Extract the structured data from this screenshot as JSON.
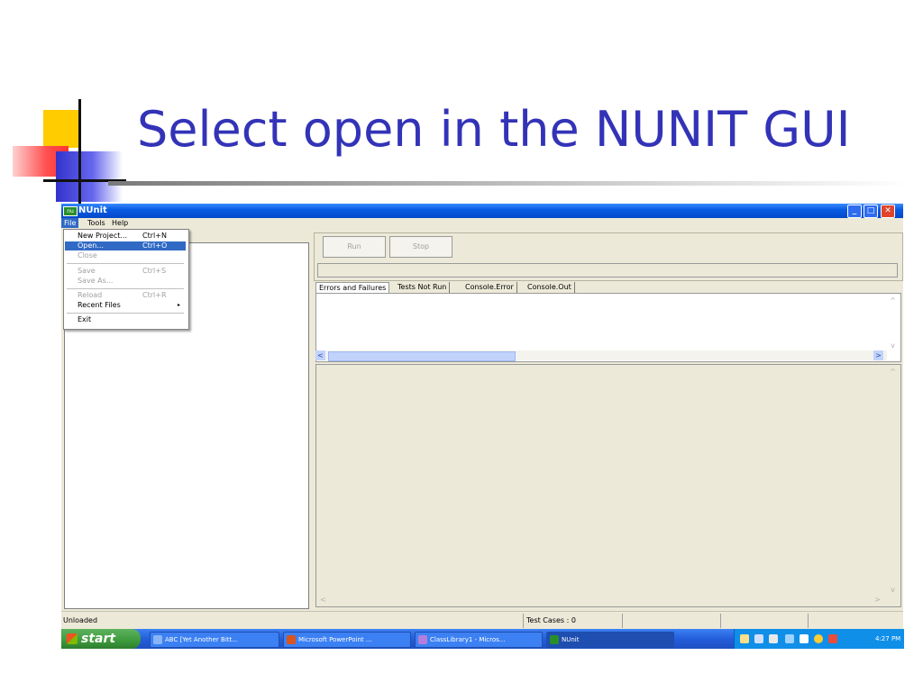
{
  "slide": {
    "title": "Select open in the NUNIT GUI"
  },
  "window": {
    "title": "NUnit",
    "icon_text": "nu",
    "controls": {
      "minimize": "_",
      "maximize": "□",
      "close": "✕"
    }
  },
  "menubar": {
    "items": [
      "File",
      "Tools",
      "Help"
    ]
  },
  "file_menu": {
    "items": [
      {
        "label": "New Project...",
        "shortcut": "Ctrl+N"
      },
      {
        "label": "Open...",
        "shortcut": "Ctrl+O"
      },
      {
        "label": "Close",
        "shortcut": ""
      },
      {
        "label": "Save",
        "shortcut": "Ctrl+S"
      },
      {
        "label": "Save As...",
        "shortcut": ""
      },
      {
        "label": "Reload",
        "shortcut": "Ctrl+R"
      },
      {
        "label": "Recent Files",
        "shortcut": ""
      },
      {
        "label": "Exit",
        "shortcut": ""
      }
    ],
    "submenu_arrow": "▸"
  },
  "toolbar": {
    "run_label": "Run",
    "stop_label": "Stop"
  },
  "tabs": [
    "Errors and Failures",
    "Tests Not Run",
    "Console.Error",
    "Console.Out"
  ],
  "scroll": {
    "up": "^",
    "down": "v",
    "left": "<",
    "right": ">"
  },
  "status": {
    "left": "Unloaded",
    "test_cases": "Test Cases : 0"
  },
  "taskbar": {
    "start_label": "start",
    "items": [
      "ABC [Yet Another Bitt...",
      "Microsoft PowerPoint ...",
      "ClassLibrary1 - Micros...",
      "NUnit"
    ],
    "clock": "4:27 PM"
  },
  "colors": {
    "title_blue": "#3333b8",
    "xp_titlebar": "#0a5ce4",
    "menu_highlight": "#316ac5"
  }
}
